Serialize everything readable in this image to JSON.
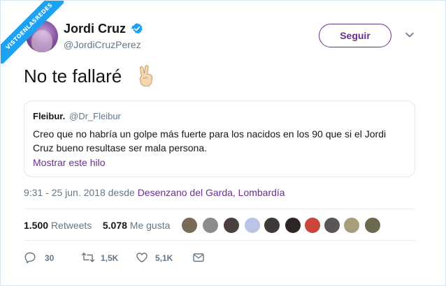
{
  "watermark": {
    "text": "VISTOENLASREDES"
  },
  "author": {
    "name": "Jordi Cruz",
    "handle": "@JordiCruzPerez",
    "verified": true
  },
  "follow_button": {
    "label": "Seguir"
  },
  "tweet": {
    "text": "No te fallaré",
    "emoji": "victory-hand"
  },
  "quoted": {
    "name": "Fleibur.",
    "handle": "@Dr_Fleibur",
    "text": "Creo que no habría un golpe más fuerte para los nacidos en los 90 que si el Jordi Cruz bueno resultase ser mala persona.",
    "show_thread": "Mostrar este hilo"
  },
  "meta": {
    "time": "9:31 - 25 jun. 2018 desde ",
    "location": "Desenzano del Garda, Lombardía"
  },
  "stats": {
    "retweets_count": "1.500",
    "retweets_label": "Retweets",
    "likes_count": "5.078",
    "likes_label": "Me gusta"
  },
  "actions": {
    "reply_count": "30",
    "retweet_count": "1,5K",
    "like_count": "5,1K"
  },
  "colors": {
    "accent": "#6b2f8e",
    "verified": "#1da1f2",
    "muted": "#657786"
  }
}
